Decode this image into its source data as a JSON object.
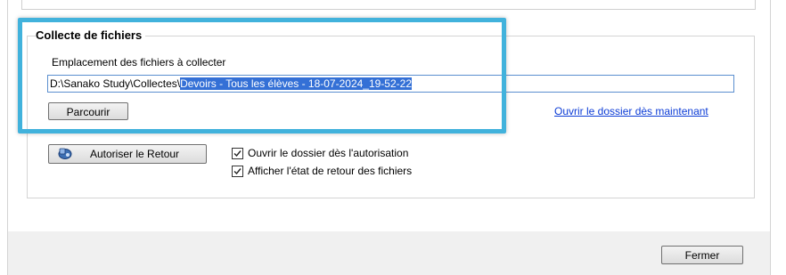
{
  "group": {
    "title": "Collecte de fichiers",
    "path_label": "Emplacement des fichiers à collecter",
    "path_prefix": "D:\\Sanako Study\\Collectes\\",
    "path_selected": "Devoirs - Tous les élèves - 18-07-2024_19-52-22",
    "browse_label": "Parcourir",
    "open_now_link": "Ouvrir le dossier dès maintenant",
    "return_label": "Autoriser le Retour",
    "checkboxes": [
      {
        "label": "Ouvrir le dossier dès l'autorisation",
        "checked": true
      },
      {
        "label": "Afficher l'état de retour des fichiers",
        "checked": true
      }
    ]
  },
  "footer": {
    "close_label": "Fermer"
  },
  "colors": {
    "highlight": "#41b2dc",
    "selection": "#3470d6",
    "link": "#0b3bd6"
  },
  "icons": {
    "return_button_icon": "return-icon"
  }
}
